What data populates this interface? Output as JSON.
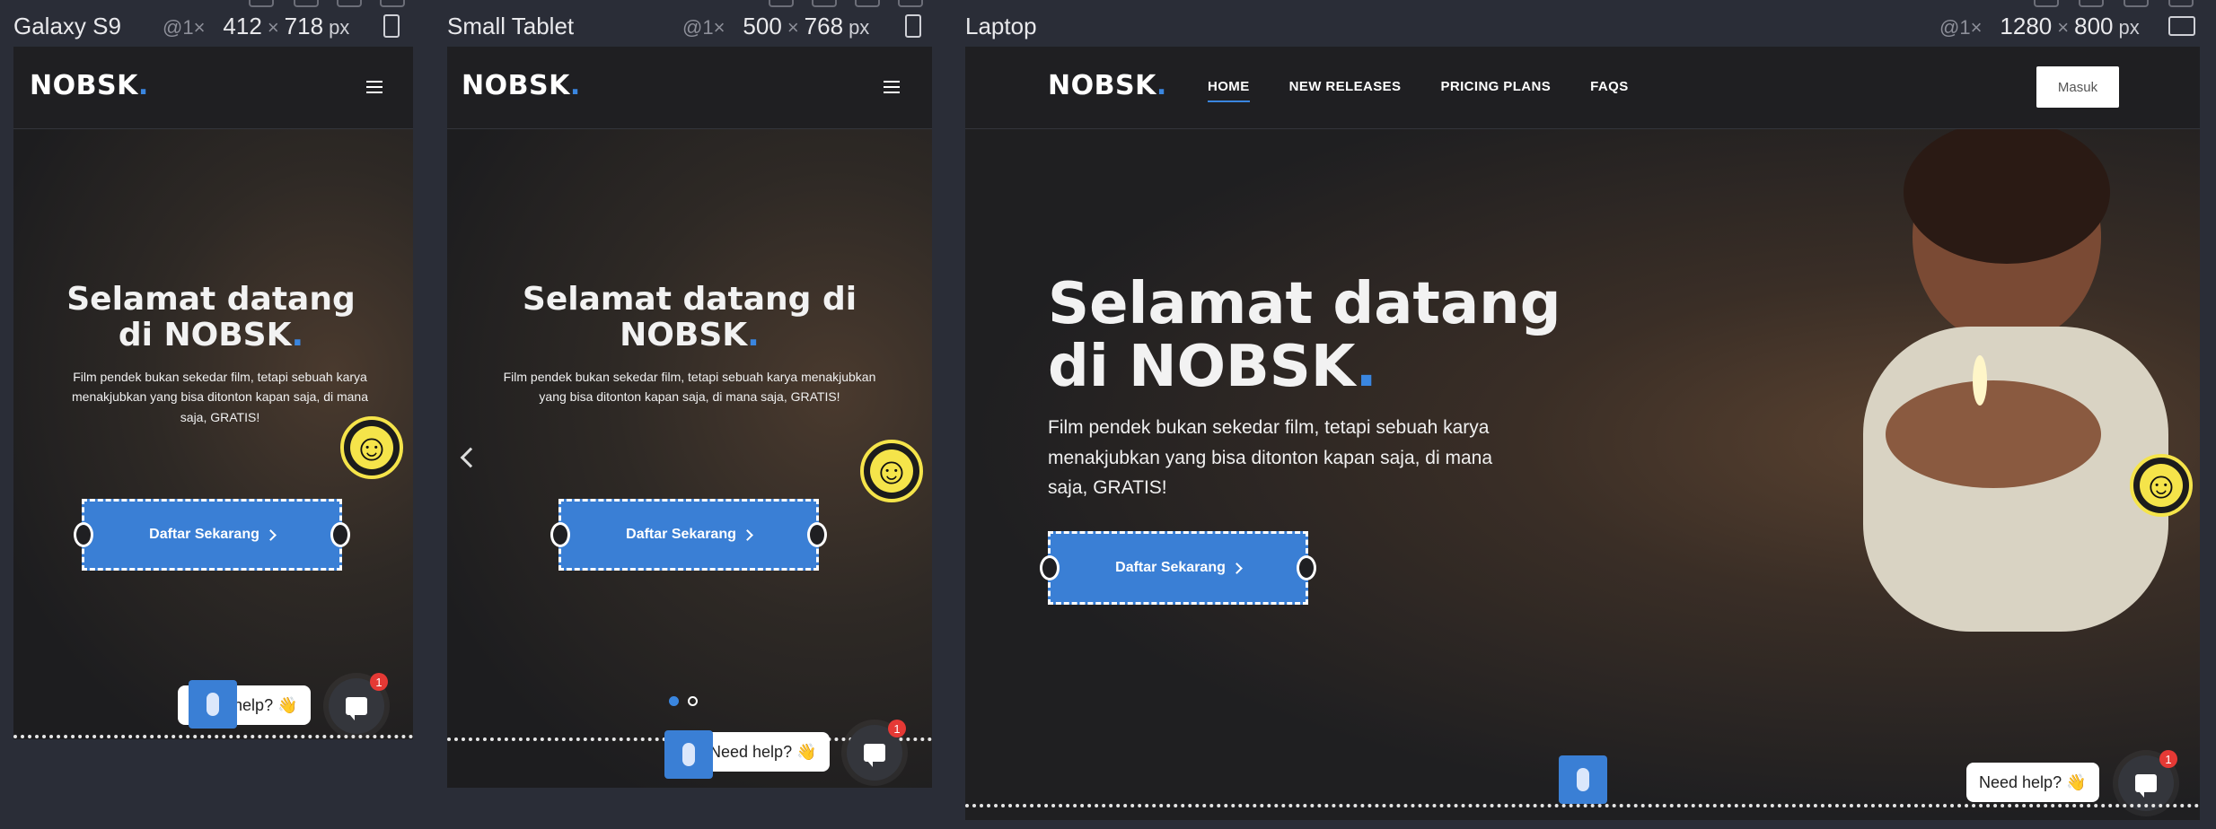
{
  "devices": [
    {
      "name": "Galaxy S9",
      "scale": "@1×",
      "width": "412",
      "height": "718",
      "unit": "px"
    },
    {
      "name": "Small Tablet",
      "scale": "@1×",
      "width": "500",
      "height": "768",
      "unit": "px"
    },
    {
      "name": "Laptop",
      "scale": "@1×",
      "width": "1280",
      "height": "800",
      "unit": "px"
    }
  ],
  "site": {
    "logo": "NOBSK",
    "logo_dot": ".",
    "nav": [
      "HOME",
      "NEW RELEASES",
      "PRICING PLANS",
      "FAQS"
    ],
    "login_label": "Masuk",
    "hero_title_1": "Selamat datang",
    "hero_title_2": "di NOBSK",
    "hero_title_tablet_1": "Selamat datang di",
    "hero_title_tablet_2": "NOBSK",
    "hero_subtitle": "Film pendek bukan sekedar film, tetapi sebuah karya menakjubkan yang bisa ditonton kapan saja, di mana saja, GRATIS!",
    "cta_label": "Daftar Sekarang",
    "help_label": "Need help? 👋",
    "chat_badge": "1"
  },
  "colors": {
    "accent": "#3a86e0",
    "cta": "#3a7fd5",
    "accessibility": "#f5e44a",
    "badge": "#e53935"
  }
}
